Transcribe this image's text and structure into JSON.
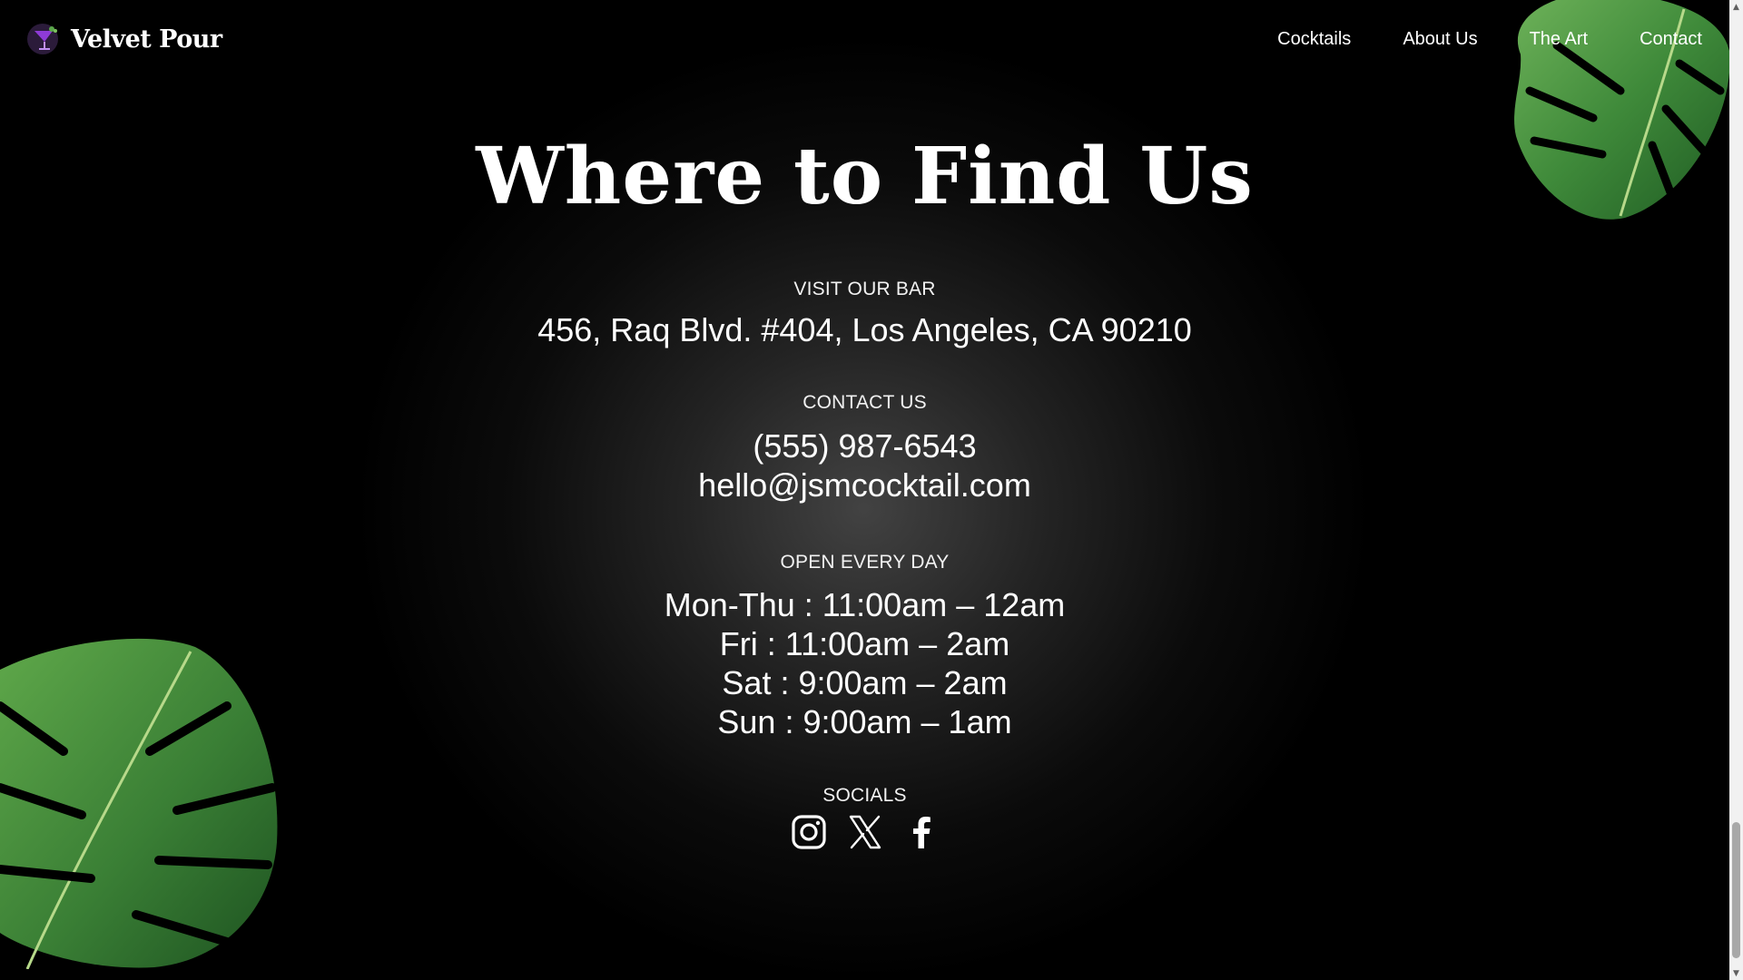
{
  "brand": {
    "name": "Velvet Pour",
    "logo_icon": "cocktail-glass-icon"
  },
  "nav": {
    "links": [
      "Cocktails",
      "About Us",
      "The Art",
      "Contact"
    ]
  },
  "page": {
    "title": "Where to Find Us",
    "visit": {
      "label": "VISIT OUR BAR",
      "address": "456, Raq Blvd. #404, Los Angeles, CA 90210"
    },
    "contact": {
      "label": "CONTACT US",
      "phone": "(555) 987-6543",
      "email": "hello@jsmcocktail.com"
    },
    "hours": {
      "label": "OPEN EVERY DAY",
      "lines": [
        "Mon-Thu : 11:00am – 12am",
        "Fri : 11:00am – 2am",
        "Sat : 9:00am – 2am",
        "Sun : 9:00am – 1am"
      ]
    },
    "socials": {
      "label": "SOCIALS",
      "icons": [
        "instagram-icon",
        "x-twitter-icon",
        "facebook-icon"
      ]
    }
  },
  "colors": {
    "background": "#000000",
    "text": "#ffffff",
    "leaf": "#3f8a3a",
    "logo_purple": "#8e3bd6"
  },
  "scrollbar": {
    "position_fraction": 0.88
  }
}
